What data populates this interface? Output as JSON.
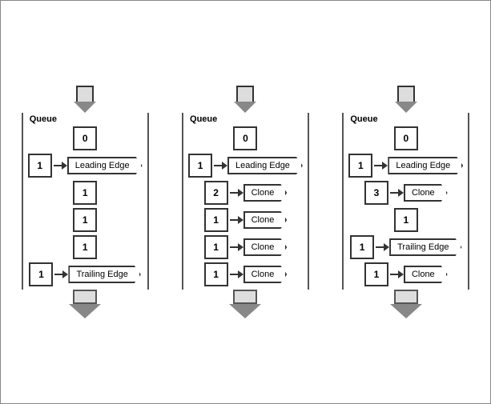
{
  "diagrams": [
    {
      "id": "diagram-1",
      "queue_label": "Queue",
      "cells": [
        {
          "value": "0",
          "label": null,
          "label_dir": null
        },
        {
          "value": "1",
          "label": "Leading Edge",
          "label_dir": "right"
        },
        {
          "value": "1",
          "label": null,
          "label_dir": null
        },
        {
          "value": "1",
          "label": null,
          "label_dir": null
        },
        {
          "value": "1",
          "label": null,
          "label_dir": null
        },
        {
          "value": "1",
          "label": "Trailing Edge",
          "label_dir": "right"
        }
      ]
    },
    {
      "id": "diagram-2",
      "queue_label": "Queue",
      "cells": [
        {
          "value": "0",
          "label": null,
          "label_dir": null
        },
        {
          "value": "1",
          "label": "Leading Edge",
          "label_dir": "right"
        },
        {
          "value": "2",
          "label": "Clone",
          "label_dir": "right"
        },
        {
          "value": "1",
          "label": "Clone",
          "label_dir": "right"
        },
        {
          "value": "1",
          "label": "Clone",
          "label_dir": "right"
        },
        {
          "value": "1",
          "label": "Clone",
          "label_dir": "right"
        }
      ]
    },
    {
      "id": "diagram-3",
      "queue_label": "Queue",
      "cells": [
        {
          "value": "0",
          "label": null,
          "label_dir": null
        },
        {
          "value": "1",
          "label": "Leading Edge",
          "label_dir": "right"
        },
        {
          "value": "3",
          "label": "Clone",
          "label_dir": "right"
        },
        {
          "value": "1",
          "label": null,
          "label_dir": null
        },
        {
          "value": "1",
          "label": "Trailing Edge",
          "label_dir": "right"
        },
        {
          "value": "1",
          "label": "Clone",
          "label_dir": "right"
        }
      ]
    }
  ]
}
